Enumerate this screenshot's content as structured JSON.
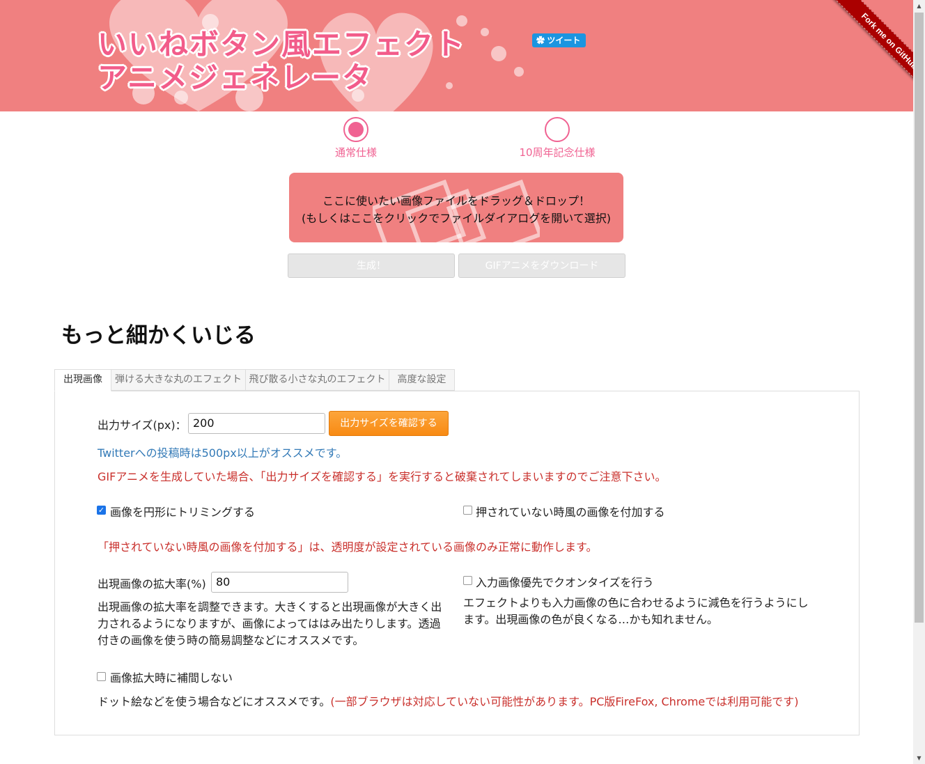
{
  "header": {
    "title_line1": "いいねボタン風エフェクト",
    "title_line2": "アニメジェネレータ",
    "tweet_label": "ツイート",
    "fork_ribbon": "Fork me on GitHub"
  },
  "modes": [
    {
      "label": "通常仕様",
      "selected": true
    },
    {
      "label": "10周年記念仕様",
      "selected": false
    }
  ],
  "dropzone": {
    "line1": "ここに使いたい画像ファイルをドラッグ＆ドロップ！",
    "line2": "(もしくはここをクリックでファイルダイアログを開いて選択)"
  },
  "actions": {
    "generate": "生成！",
    "download": "GIFアニメをダウンロード"
  },
  "section_title": "もっと細かくいじる",
  "tabs": [
    {
      "label": "出現画像",
      "active": true
    },
    {
      "label": "弾ける大きな丸のエフェクト",
      "active": false
    },
    {
      "label": "飛び散る小さな丸のエフェクト",
      "active": false
    },
    {
      "label": "高度な設定",
      "active": false
    }
  ],
  "panel": {
    "output_size_label": "出力サイズ(px)：",
    "output_size_value": "200",
    "confirm_size_button": "出力サイズを確認する",
    "twitter_note": "Twitterへの投稿時は500px以上がオススメです。",
    "warning_note": "GIFアニメを生成していた場合、「出力サイズを確認する」を実行すると破棄されてしまいますのでご注意下さい。",
    "trim_circle": {
      "label": "画像を円形にトリミングする",
      "checked": true
    },
    "unpressed_image": {
      "label": "押されていない時風の画像を付加する",
      "checked": false
    },
    "unpressed_note": "「押されていない時風の画像を付加する」は、透明度が設定されている画像のみ正常に動作します。",
    "scale_label": "出現画像の拡大率(%)",
    "scale_value": "80",
    "scale_desc_1": "出現画像の拡大率を調整できます。大きくすると出現画像が大きく出",
    "scale_desc_2": "力されるようになりますが、画像によってははみ出たりします。透過",
    "scale_desc_3": "付きの画像を使う時の簡易調整などにオススメです。",
    "quantize": {
      "label": "入力画像優先でクオンタイズを行う",
      "checked": false
    },
    "quantize_desc_1": "エフェクトよりも入力画像の色に合わせるように減色を行うようにし",
    "quantize_desc_2": "ます。出現画像の色が良くなる…かも知れません。",
    "no_interp": {
      "label": "画像拡大時に補間しない",
      "checked": false
    },
    "no_interp_desc": "ドット絵などを使う場合などにオススメです。",
    "no_interp_warn": "(一部ブラウザは対応していない可能性があります。PC版FireFox, Chromeでは利用可能です)"
  },
  "colors": {
    "header_bg": "#f08080",
    "accent_pink": "#f06292",
    "button_orange": "#f88a13",
    "note_blue": "#337ab7",
    "note_red": "#c9302c"
  }
}
